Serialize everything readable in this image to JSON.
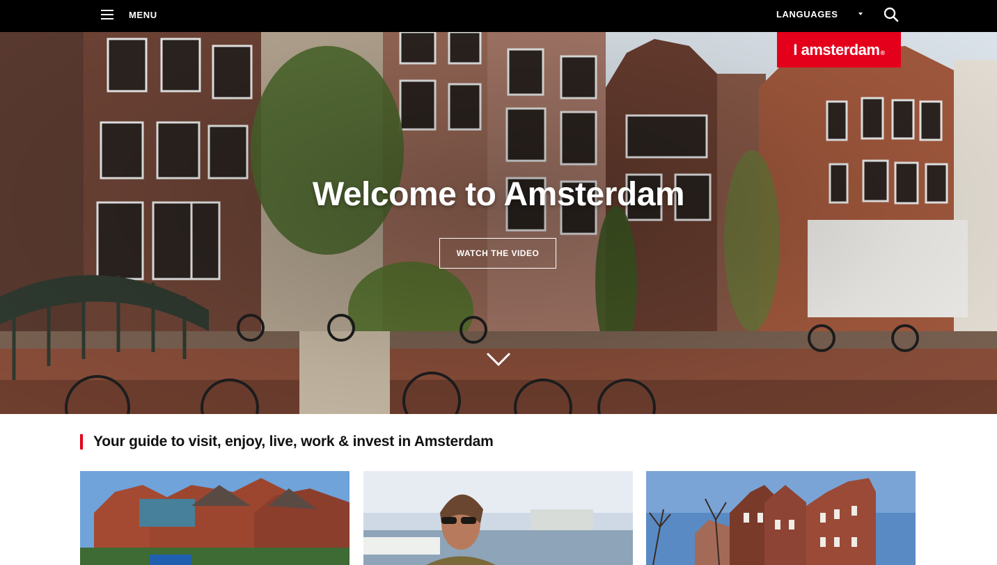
{
  "header": {
    "menu_label": "MENU",
    "languages_label": "LANGUAGES",
    "logo_text": "I amsterdam",
    "logo_reg": "®"
  },
  "hero": {
    "title": "Welcome to Amsterdam",
    "video_button": "WATCH THE VIDEO"
  },
  "guide": {
    "heading": "Your guide to visit, enjoy, live, work & invest in Amsterdam",
    "accent_color": "#e4001b"
  },
  "colors": {
    "topbar": "#000000",
    "brand_red": "#e4001b"
  },
  "icons": {
    "menu": "hamburger-icon",
    "languages": "caret-down-icon",
    "search": "search-icon",
    "scroll": "chevron-down-icon"
  }
}
